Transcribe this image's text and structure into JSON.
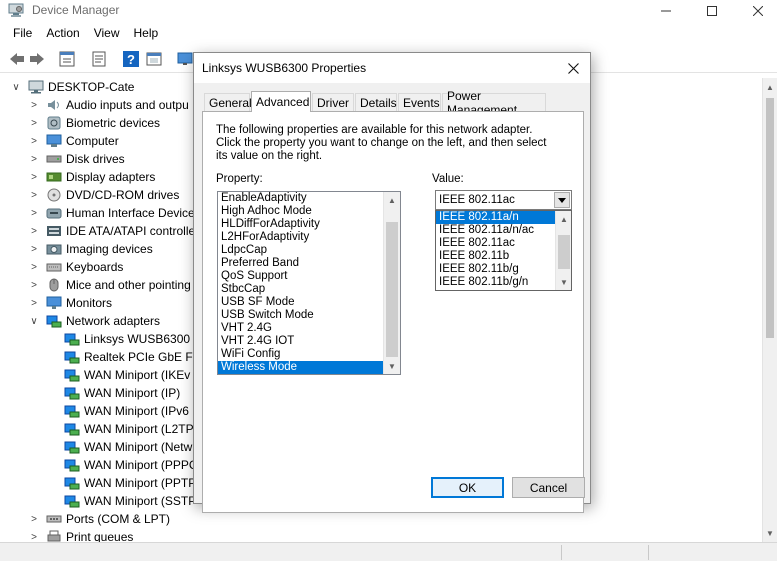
{
  "device_manager": {
    "title": "Device Manager",
    "window_controls": {
      "minimize": "—",
      "maximize": "☐",
      "close": "✕"
    },
    "menu": [
      "File",
      "Action",
      "View",
      "Help"
    ],
    "toolbar_icons": [
      "back-arrow-icon",
      "forward-arrow-icon",
      "show-hidden-icon",
      "properties-icon",
      "help-icon",
      "update-driver-icon",
      "monitor-icon"
    ],
    "tree": {
      "root": "DESKTOP-Cate",
      "categories": [
        {
          "label": "Audio inputs and outpu",
          "icon": "speaker-icon"
        },
        {
          "label": "Biometric devices",
          "icon": "biometric-icon"
        },
        {
          "label": "Computer",
          "icon": "computer-icon"
        },
        {
          "label": "Disk drives",
          "icon": "disk-icon"
        },
        {
          "label": "Display adapters",
          "icon": "display-adapter-icon"
        },
        {
          "label": "DVD/CD-ROM drives",
          "icon": "dvd-icon"
        },
        {
          "label": "Human Interface Device",
          "icon": "hid-icon"
        },
        {
          "label": "IDE ATA/ATAPI controlle",
          "icon": "ide-icon"
        },
        {
          "label": "Imaging devices",
          "icon": "camera-icon"
        },
        {
          "label": "Keyboards",
          "icon": "keyboard-icon"
        },
        {
          "label": "Mice and other pointing",
          "icon": "mouse-icon"
        },
        {
          "label": "Monitors",
          "icon": "monitor-icon"
        }
      ],
      "network_adapters": {
        "label": "Network adapters",
        "children": [
          "Linksys WUSB6300",
          "Realtek PCIe GbE Far",
          "WAN Miniport (IKEv",
          "WAN Miniport (IP)",
          "WAN Miniport (IPv6",
          "WAN Miniport (L2TP",
          "WAN Miniport (Netw",
          "WAN Miniport (PPPC",
          "WAN Miniport (PPTP",
          "WAN Miniport (SSTP"
        ]
      },
      "after": [
        {
          "label": "Ports (COM & LPT)",
          "icon": "port-icon"
        },
        {
          "label": "Print queues",
          "icon": "printer-icon"
        }
      ]
    }
  },
  "dialog": {
    "title": "Linksys WUSB6300 Properties",
    "close": "✕",
    "tabs": [
      "General",
      "Advanced",
      "Driver",
      "Details",
      "Events",
      "Power Management"
    ],
    "active_tab": "Advanced",
    "description": "The following properties are available for this network adapter. Click the property you want to change on the left, and then select its value on the right.",
    "property_label": "Property:",
    "value_label": "Value:",
    "properties": [
      "EnableAdaptivity",
      "High Adhoc Mode",
      "HLDiffForAdaptivity",
      "L2HForAdaptivity",
      "LdpcCap",
      "Preferred Band",
      "QoS Support",
      "StbcCap",
      "USB SF Mode",
      "USB Switch Mode",
      "VHT 2.4G",
      "VHT 2.4G IOT",
      "WiFi Config",
      "Wireless Mode"
    ],
    "selected_property": "Wireless Mode",
    "value_combo": "IEEE 802.11ac",
    "value_options": [
      "IEEE 802.11a/n",
      "IEEE 802.11a/n/ac",
      "IEEE 802.11ac",
      "IEEE 802.11b",
      "IEEE 802.11b/g",
      "IEEE 802.11b/g/n"
    ],
    "highlighted_option": "IEEE 802.11a/n",
    "ok_label": "OK",
    "cancel_label": "Cancel"
  },
  "colors": {
    "selection": "#0078d7",
    "dialog_bg": "#f0f0f0",
    "adapter_icon": "#1e88e5"
  }
}
